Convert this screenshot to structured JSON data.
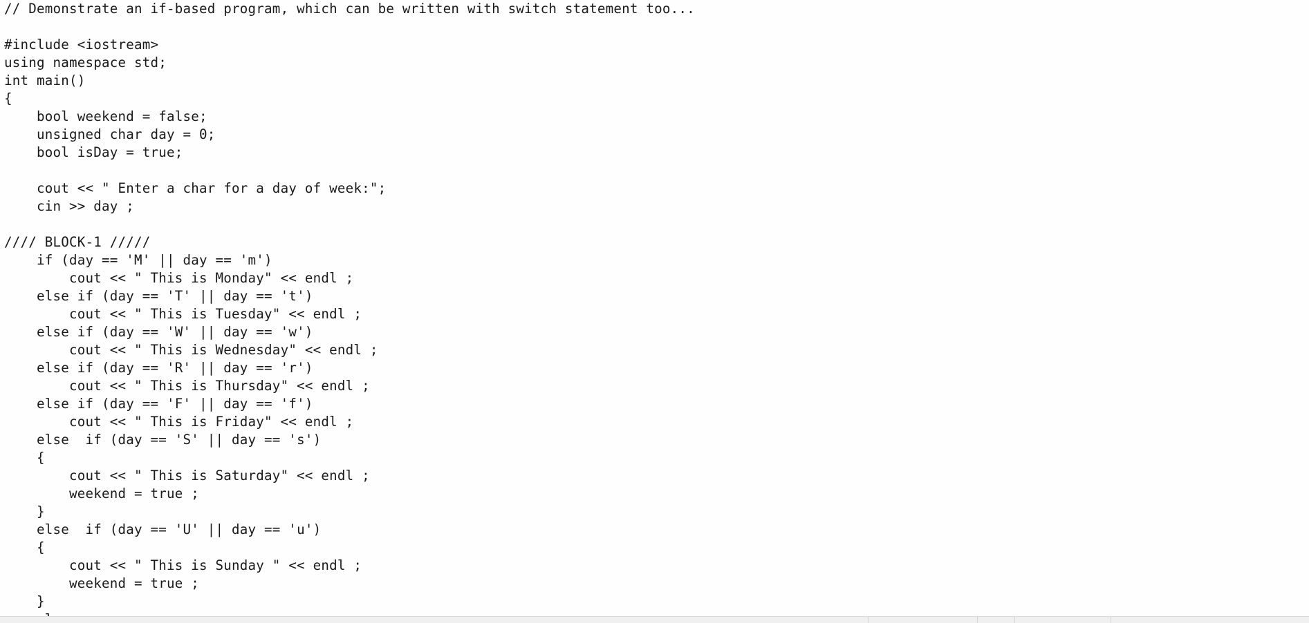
{
  "editor": {
    "lines": [
      "// Demonstrate an if-based program, which can be written with switch statement too...",
      "",
      "#include <iostream>",
      "using namespace std;",
      "int main()",
      "{",
      "    bool weekend = false;",
      "    unsigned char day = 0;",
      "    bool isDay = true;",
      "",
      "    cout << \" Enter a char for a day of week:\";",
      "    cin >> day ;",
      "",
      "//// BLOCK-1 /////",
      "    if (day == 'M' || day == 'm')",
      "        cout << \" This is Monday\" << endl ;",
      "    else if (day == 'T' || day == 't')",
      "        cout << \" This is Tuesday\" << endl ;",
      "    else if (day == 'W' || day == 'w')",
      "        cout << \" This is Wednesday\" << endl ;",
      "    else if (day == 'R' || day == 'r')",
      "        cout << \" This is Thursday\" << endl ;",
      "    else if (day == 'F' || day == 'f')",
      "        cout << \" This is Friday\" << endl ;",
      "    else  if (day == 'S' || day == 's')",
      "    {",
      "        cout << \" This is Saturday\" << endl ;",
      "        weekend = true ;",
      "    }",
      "    else  if (day == 'U' || day == 'u')",
      "    {",
      "        cout << \" This is Sunday \" << endl ;",
      "        weekend = true ;",
      "    }",
      "    else"
    ]
  }
}
